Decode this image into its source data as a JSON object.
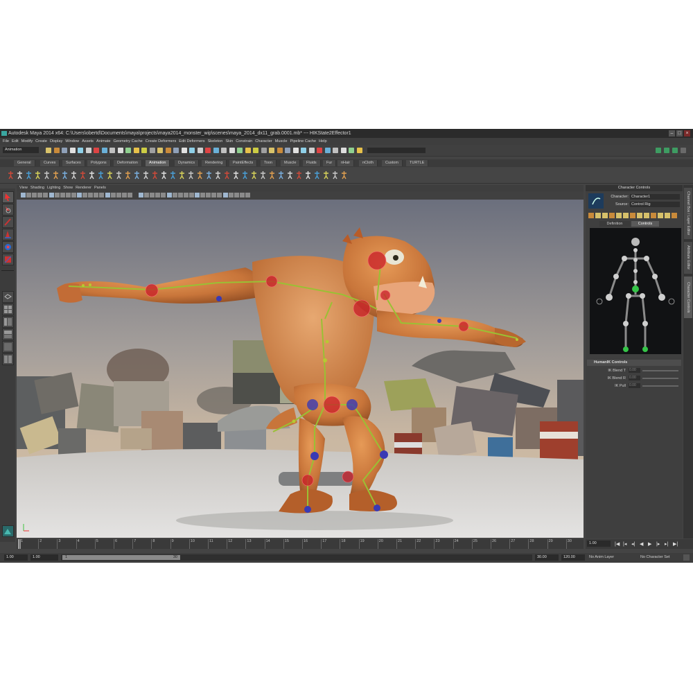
{
  "window": {
    "title": "Autodesk Maya 2014 x64: C:\\Users\\obertd\\Documents\\maya\\projects\\maya2014_monster_wip\\scenes\\maya_2014_dx11_grab.0001.mb*  ---  HIKState2Effector1",
    "buttons": [
      "–",
      "□",
      "×"
    ]
  },
  "menubar": [
    "File",
    "Edit",
    "Modify",
    "Create",
    "Display",
    "Window",
    "Assets",
    "Animate",
    "Geometry Cache",
    "Create Deformers",
    "Edit Deformers",
    "Skeleton",
    "Skin",
    "Constrain",
    "Character",
    "Muscle",
    "Pipeline Cache",
    "Help"
  ],
  "statusline": {
    "mode": "Animation"
  },
  "shelf": {
    "tabs": [
      "General",
      "Curves",
      "Surfaces",
      "Polygons",
      "Deformation",
      "Animation",
      "Dynamics",
      "Rendering",
      "PaintEffects",
      "Toon",
      "Muscle",
      "Fluids",
      "Fur",
      "nHair",
      "nCloth",
      "Custom",
      "TURTLE"
    ],
    "active_tab": "Animation"
  },
  "panel_menu": [
    "View",
    "Shading",
    "Lighting",
    "Show",
    "Renderer",
    "Panels"
  ],
  "character_controls": {
    "header": "Character Controls",
    "character_label": "Character:",
    "character_value": "Character1",
    "source_label": "Source:",
    "source_value": "Control Rig",
    "tabs": [
      "Definition",
      "Controls"
    ],
    "active_tab": "Controls",
    "section": "HumanIK Controls",
    "sliders": [
      {
        "label": "IK Blend T",
        "value": "0.00"
      },
      {
        "label": "IK Blend R",
        "value": "0.00"
      },
      {
        "label": "IK Pull",
        "value": "0.00"
      }
    ]
  },
  "side_tabs": [
    "Channel Box / Layer Editor",
    "Attribute Editor",
    "Character Controls"
  ],
  "timeline": {
    "ticks": [
      "1",
      "2",
      "3",
      "4",
      "5",
      "6",
      "7",
      "8",
      "9",
      "10",
      "11",
      "12",
      "13",
      "14",
      "15",
      "16",
      "17",
      "18",
      "19",
      "20",
      "21",
      "22",
      "23",
      "24",
      "25",
      "26",
      "27",
      "28",
      "29",
      "30"
    ],
    "current_frame": "1.00"
  },
  "range": {
    "start": "1.00",
    "playback_start": "1.00",
    "slider_start": "1",
    "slider_end": "30",
    "playback_end": "30.00",
    "end": "120.00",
    "anim_layer": "No Anim Layer",
    "character_set": "No Character Set"
  },
  "colors": {
    "ui_bg": "#444444",
    "accent": "#3aa6a0",
    "ik_red": "#c81e28",
    "fk_blue": "#3a3ab4",
    "bone_green": "#9ac034",
    "monster_skin": "#c8753a"
  }
}
